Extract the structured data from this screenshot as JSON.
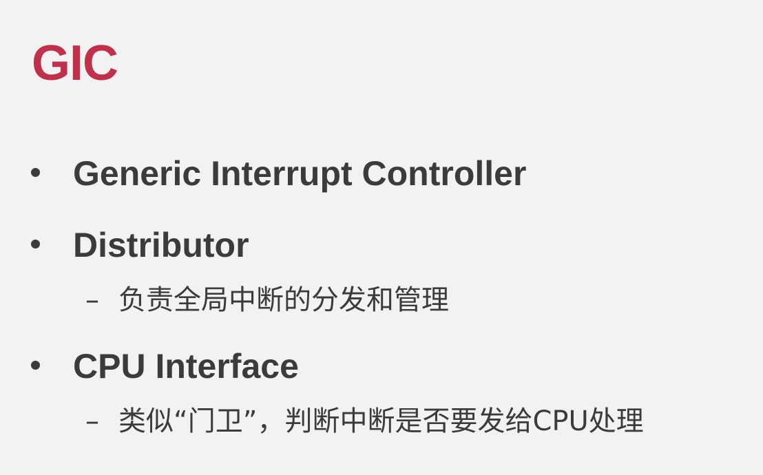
{
  "title": "GIC",
  "title_color": "#c0304a",
  "text_color": "#3b3b3b",
  "bullets": [
    {
      "text": "Generic Interrupt Controller"
    },
    {
      "text": "Distributor",
      "sub": "负责全局中断的分发和管理"
    },
    {
      "text": "CPU Interface",
      "sub": "类似“门卫”，判断中断是否要发给CPU处理"
    }
  ],
  "sub_marker": "–"
}
